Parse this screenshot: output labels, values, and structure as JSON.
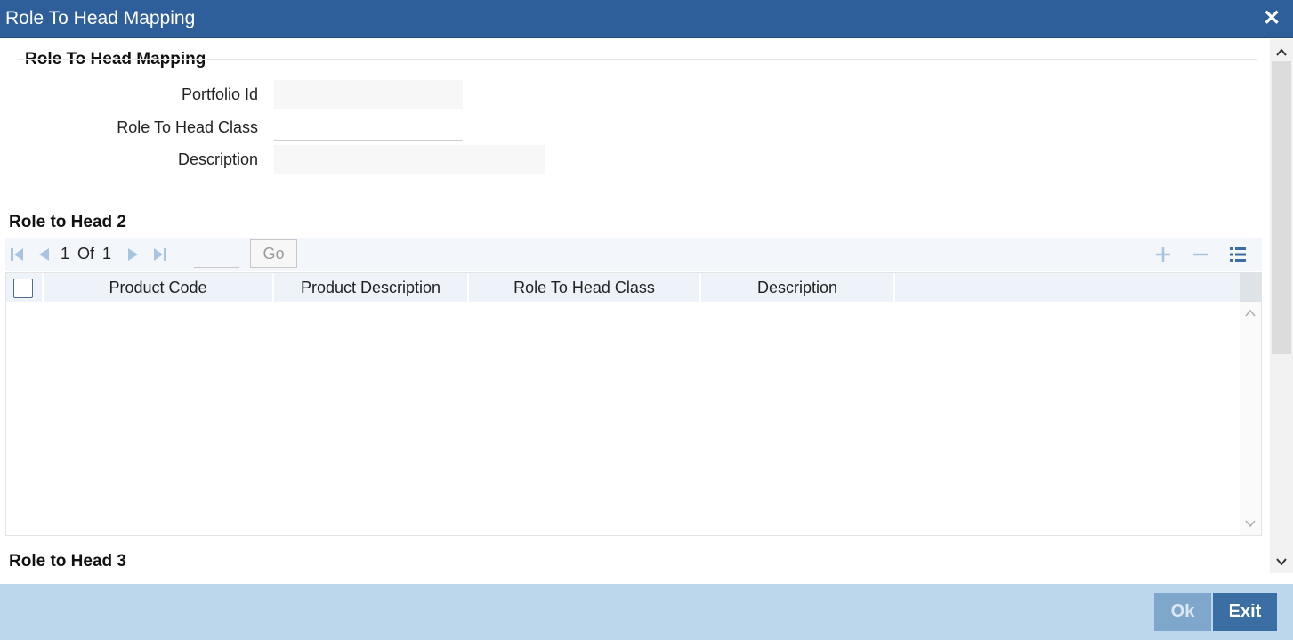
{
  "window": {
    "title": "Role To Head Mapping"
  },
  "header_section": {
    "title": "Role To Head Mapping",
    "fields": [
      {
        "label": "Portfolio Id",
        "value": ""
      },
      {
        "label": "Role To Head Class",
        "value": ""
      },
      {
        "label": "Description",
        "value": ""
      }
    ]
  },
  "grid_section": {
    "title": "Role to Head 2",
    "pagination": {
      "current": "1",
      "of_label": "Of",
      "total": "1",
      "page_input": "",
      "go_label": "Go"
    },
    "columns": [
      "Product Code",
      "Product Description",
      "Role To Head Class",
      "Description"
    ],
    "rows": []
  },
  "next_section": {
    "title": "Role to Head 3"
  },
  "footer": {
    "ok_label": "Ok",
    "exit_label": "Exit"
  },
  "colors": {
    "titlebar": "#2f5f9a",
    "footer": "#bcd7eb",
    "button": "#3b6ea3"
  }
}
